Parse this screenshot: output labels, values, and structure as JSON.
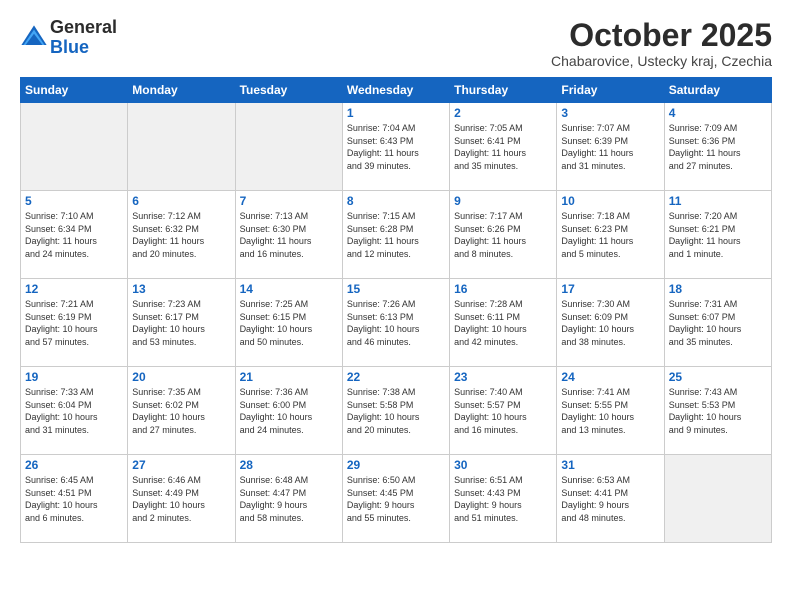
{
  "logo": {
    "general": "General",
    "blue": "Blue"
  },
  "title": "October 2025",
  "location": "Chabarovice, Ustecky kraj, Czechia",
  "days_of_week": [
    "Sunday",
    "Monday",
    "Tuesday",
    "Wednesday",
    "Thursday",
    "Friday",
    "Saturday"
  ],
  "weeks": [
    [
      {
        "day": "",
        "info": "",
        "empty": true
      },
      {
        "day": "",
        "info": "",
        "empty": true
      },
      {
        "day": "",
        "info": "",
        "empty": true
      },
      {
        "day": "1",
        "info": "Sunrise: 7:04 AM\nSunset: 6:43 PM\nDaylight: 11 hours\nand 39 minutes."
      },
      {
        "day": "2",
        "info": "Sunrise: 7:05 AM\nSunset: 6:41 PM\nDaylight: 11 hours\nand 35 minutes."
      },
      {
        "day": "3",
        "info": "Sunrise: 7:07 AM\nSunset: 6:39 PM\nDaylight: 11 hours\nand 31 minutes."
      },
      {
        "day": "4",
        "info": "Sunrise: 7:09 AM\nSunset: 6:36 PM\nDaylight: 11 hours\nand 27 minutes."
      }
    ],
    [
      {
        "day": "5",
        "info": "Sunrise: 7:10 AM\nSunset: 6:34 PM\nDaylight: 11 hours\nand 24 minutes."
      },
      {
        "day": "6",
        "info": "Sunrise: 7:12 AM\nSunset: 6:32 PM\nDaylight: 11 hours\nand 20 minutes."
      },
      {
        "day": "7",
        "info": "Sunrise: 7:13 AM\nSunset: 6:30 PM\nDaylight: 11 hours\nand 16 minutes."
      },
      {
        "day": "8",
        "info": "Sunrise: 7:15 AM\nSunset: 6:28 PM\nDaylight: 11 hours\nand 12 minutes."
      },
      {
        "day": "9",
        "info": "Sunrise: 7:17 AM\nSunset: 6:26 PM\nDaylight: 11 hours\nand 8 minutes."
      },
      {
        "day": "10",
        "info": "Sunrise: 7:18 AM\nSunset: 6:23 PM\nDaylight: 11 hours\nand 5 minutes."
      },
      {
        "day": "11",
        "info": "Sunrise: 7:20 AM\nSunset: 6:21 PM\nDaylight: 11 hours\nand 1 minute."
      }
    ],
    [
      {
        "day": "12",
        "info": "Sunrise: 7:21 AM\nSunset: 6:19 PM\nDaylight: 10 hours\nand 57 minutes."
      },
      {
        "day": "13",
        "info": "Sunrise: 7:23 AM\nSunset: 6:17 PM\nDaylight: 10 hours\nand 53 minutes."
      },
      {
        "day": "14",
        "info": "Sunrise: 7:25 AM\nSunset: 6:15 PM\nDaylight: 10 hours\nand 50 minutes."
      },
      {
        "day": "15",
        "info": "Sunrise: 7:26 AM\nSunset: 6:13 PM\nDaylight: 10 hours\nand 46 minutes."
      },
      {
        "day": "16",
        "info": "Sunrise: 7:28 AM\nSunset: 6:11 PM\nDaylight: 10 hours\nand 42 minutes."
      },
      {
        "day": "17",
        "info": "Sunrise: 7:30 AM\nSunset: 6:09 PM\nDaylight: 10 hours\nand 38 minutes."
      },
      {
        "day": "18",
        "info": "Sunrise: 7:31 AM\nSunset: 6:07 PM\nDaylight: 10 hours\nand 35 minutes."
      }
    ],
    [
      {
        "day": "19",
        "info": "Sunrise: 7:33 AM\nSunset: 6:04 PM\nDaylight: 10 hours\nand 31 minutes."
      },
      {
        "day": "20",
        "info": "Sunrise: 7:35 AM\nSunset: 6:02 PM\nDaylight: 10 hours\nand 27 minutes."
      },
      {
        "day": "21",
        "info": "Sunrise: 7:36 AM\nSunset: 6:00 PM\nDaylight: 10 hours\nand 24 minutes."
      },
      {
        "day": "22",
        "info": "Sunrise: 7:38 AM\nSunset: 5:58 PM\nDaylight: 10 hours\nand 20 minutes."
      },
      {
        "day": "23",
        "info": "Sunrise: 7:40 AM\nSunset: 5:57 PM\nDaylight: 10 hours\nand 16 minutes."
      },
      {
        "day": "24",
        "info": "Sunrise: 7:41 AM\nSunset: 5:55 PM\nDaylight: 10 hours\nand 13 minutes."
      },
      {
        "day": "25",
        "info": "Sunrise: 7:43 AM\nSunset: 5:53 PM\nDaylight: 10 hours\nand 9 minutes."
      }
    ],
    [
      {
        "day": "26",
        "info": "Sunrise: 6:45 AM\nSunset: 4:51 PM\nDaylight: 10 hours\nand 6 minutes."
      },
      {
        "day": "27",
        "info": "Sunrise: 6:46 AM\nSunset: 4:49 PM\nDaylight: 10 hours\nand 2 minutes."
      },
      {
        "day": "28",
        "info": "Sunrise: 6:48 AM\nSunset: 4:47 PM\nDaylight: 9 hours\nand 58 minutes."
      },
      {
        "day": "29",
        "info": "Sunrise: 6:50 AM\nSunset: 4:45 PM\nDaylight: 9 hours\nand 55 minutes."
      },
      {
        "day": "30",
        "info": "Sunrise: 6:51 AM\nSunset: 4:43 PM\nDaylight: 9 hours\nand 51 minutes."
      },
      {
        "day": "31",
        "info": "Sunrise: 6:53 AM\nSunset: 4:41 PM\nDaylight: 9 hours\nand 48 minutes."
      },
      {
        "day": "",
        "info": "",
        "empty": true
      }
    ]
  ]
}
